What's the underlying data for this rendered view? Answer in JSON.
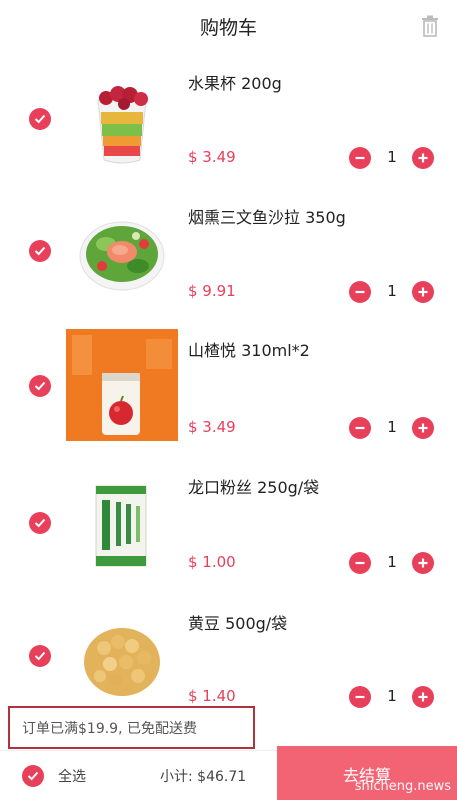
{
  "header": {
    "title": "购物车"
  },
  "items": [
    {
      "name": "水果杯  200g",
      "price": "$ 3.49",
      "qty": "1"
    },
    {
      "name": "烟熏三文鱼沙拉  350g",
      "price": "$ 9.91",
      "qty": "1"
    },
    {
      "name": "山楂悦  310ml*2",
      "price": "$ 3.49",
      "qty": "1"
    },
    {
      "name": "龙口粉丝  250g/袋",
      "price": "$ 1.00",
      "qty": "1"
    },
    {
      "name": "黄豆  500g/袋",
      "price": "$ 1.40",
      "qty": "1"
    }
  ],
  "notice": "订单已满$19.9, 已免配送费",
  "footer": {
    "select_all": "全选",
    "subtotal": "小计: $46.71",
    "checkout": "去结算"
  },
  "watermark": "shicheng.news",
  "colors": {
    "accent": "#e8405a",
    "checkout_bg": "#f26474"
  }
}
